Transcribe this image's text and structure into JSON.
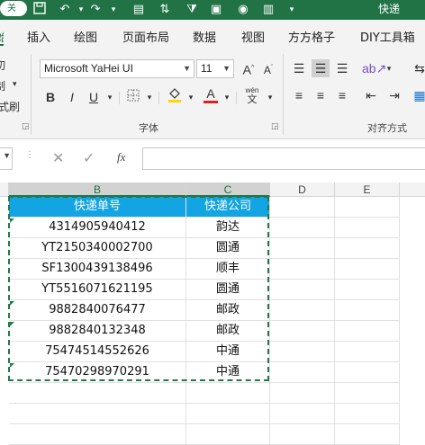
{
  "titlebar": {
    "toggle_label": "关",
    "title": "快递"
  },
  "tabs": [
    "插入",
    "绘图",
    "页面布局",
    "数据",
    "视图",
    "方方格子",
    "DIY工具箱"
  ],
  "ribbon": {
    "font_name": "Microsoft YaHei UI",
    "font_size": "11",
    "bold": "B",
    "italic": "I",
    "underline": "U",
    "font_color_glyph": "A",
    "grow_font": "A",
    "shrink_font": "A",
    "wen_label": "wén",
    "font_group_label": "字体",
    "align_group_label": "对齐方式",
    "left_partial_1": "切",
    "left_partial_2": "制",
    "left_partial_3": "式刷",
    "accent_color": "#217346",
    "highlight_color": "#ffd700",
    "font_color": "#e02020"
  },
  "formula": {
    "fx": "fx",
    "value": ""
  },
  "columns": [
    "B",
    "C",
    "D",
    "E"
  ],
  "table": {
    "headers": [
      "快递单号",
      "快递公司"
    ],
    "header_color": "#13a4e3",
    "rows": [
      [
        "4314905940412",
        "韵达"
      ],
      [
        "YT2150340002700",
        "圆通"
      ],
      [
        "SF1300439138496",
        "顺丰"
      ],
      [
        "YT5516071621195",
        "圆通"
      ],
      [
        "9882840076477",
        "邮政"
      ],
      [
        "9882840132348",
        "邮政"
      ],
      [
        "75474514552626",
        "中通"
      ],
      [
        "75470298970291",
        "中通"
      ]
    ]
  }
}
